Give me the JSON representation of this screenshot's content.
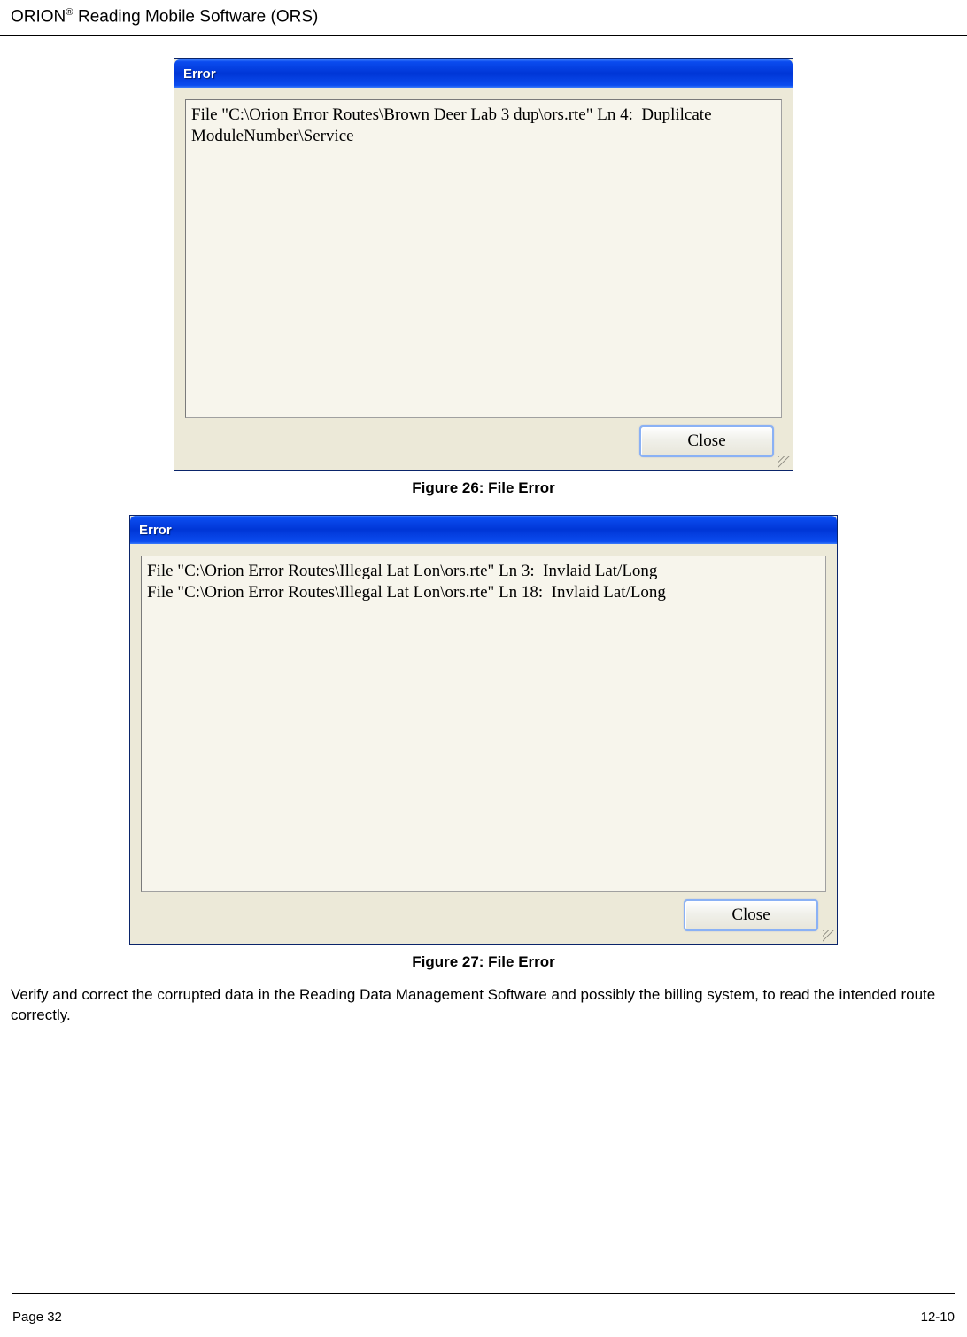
{
  "header": {
    "product_prefix": "ORION",
    "product_suffix": " Reading Mobile Software (ORS)"
  },
  "dialog1": {
    "title": "Error",
    "message": "File \"C:\\Orion Error Routes\\Brown Deer Lab 3 dup\\ors.rte\" Ln 4:  Duplilcate\nModuleNumber\\Service",
    "close_label": "Close"
  },
  "caption1": "Figure 26: File Error",
  "dialog2": {
    "title": "Error",
    "message": "File \"C:\\Orion Error Routes\\Illegal Lat Lon\\ors.rte\" Ln 3:  Invlaid Lat/Long\nFile \"C:\\Orion Error Routes\\Illegal Lat Lon\\ors.rte\" Ln 18:  Invlaid Lat/Long",
    "close_label": "Close"
  },
  "caption2": "Figure 27: File Error",
  "paragraph": "Verify and correct the corrupted data in the Reading Data Management Software and possibly the billing system, to read the intended route correctly.",
  "footer": {
    "page": "Page 32",
    "doc": "12-10"
  }
}
